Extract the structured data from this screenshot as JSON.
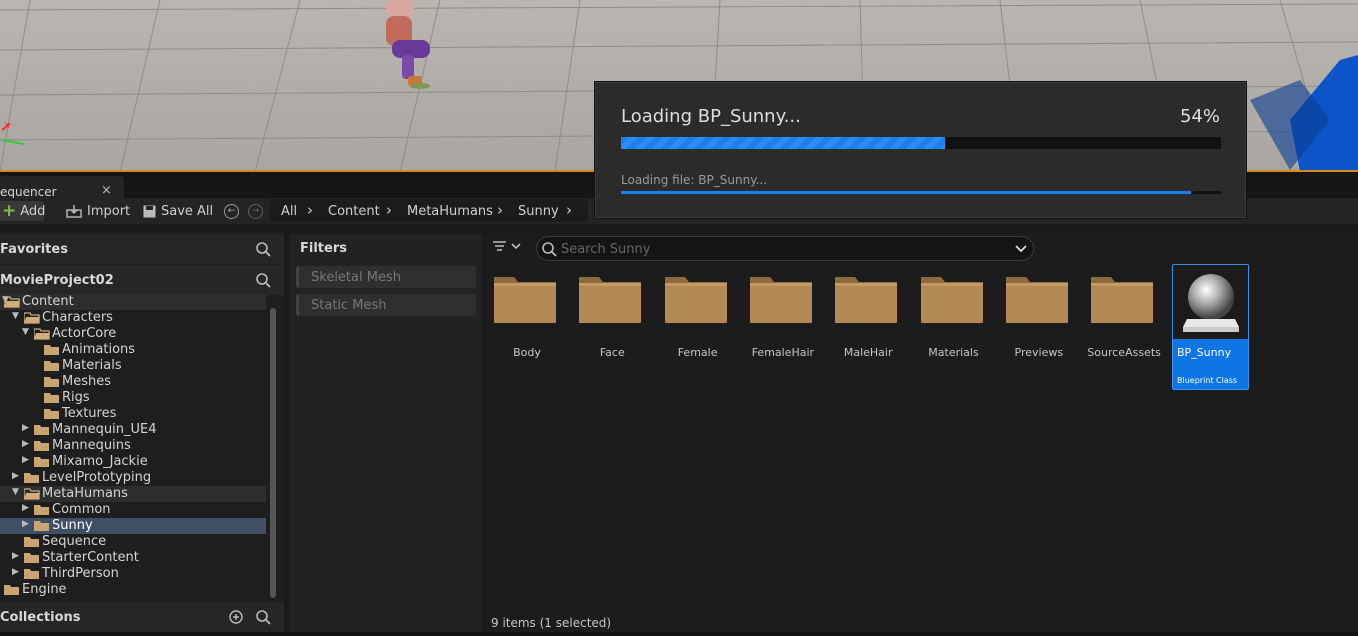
{
  "tab": {
    "label": "equencer",
    "close": "×"
  },
  "toolbar": {
    "add": "Add",
    "import": "Import",
    "save_all": "Save All",
    "breadcrumb": [
      "All",
      "Content",
      "MetaHumans",
      "Sunny"
    ]
  },
  "left": {
    "favorites": "Favorites",
    "project": "MovieProject02",
    "collections": "Collections",
    "tree": [
      {
        "label": "Content",
        "depth": 0,
        "expanded": true,
        "state": "hl"
      },
      {
        "label": "Characters",
        "depth": 1,
        "expanded": true
      },
      {
        "label": "ActorCore",
        "depth": 2,
        "expanded": true
      },
      {
        "label": "Animations",
        "depth": 3
      },
      {
        "label": "Materials",
        "depth": 3
      },
      {
        "label": "Meshes",
        "depth": 3
      },
      {
        "label": "Rigs",
        "depth": 3
      },
      {
        "label": "Textures",
        "depth": 3
      },
      {
        "label": "Mannequin_UE4",
        "depth": 2,
        "expanded": false
      },
      {
        "label": "Mannequins",
        "depth": 2,
        "expanded": false
      },
      {
        "label": "Mixamo_Jackie",
        "depth": 2,
        "expanded": false
      },
      {
        "label": "LevelPrototyping",
        "depth": 1,
        "expanded": false
      },
      {
        "label": "MetaHumans",
        "depth": 1,
        "expanded": true,
        "state": "hl"
      },
      {
        "label": "Common",
        "depth": 2,
        "expanded": false
      },
      {
        "label": "Sunny",
        "depth": 2,
        "expanded": false,
        "state": "sel"
      },
      {
        "label": "Sequence",
        "depth": 1
      },
      {
        "label": "StarterContent",
        "depth": 1,
        "expanded": false
      },
      {
        "label": "ThirdPerson",
        "depth": 1,
        "expanded": false
      },
      {
        "label": "Engine",
        "depth": 0
      }
    ]
  },
  "filters": {
    "title": "Filters",
    "items": [
      "Skeletal Mesh",
      "Static Mesh"
    ]
  },
  "assets": {
    "search_placeholder": "Search Sunny",
    "folders": [
      "Body",
      "Face",
      "Female",
      "FemaleHair",
      "MaleHair",
      "Materials",
      "Previews",
      "SourceAssets"
    ],
    "blueprint": {
      "name": "BP_Sunny",
      "type": "Blueprint Class"
    },
    "status": "9 items (1 selected)"
  },
  "loading": {
    "title": "Loading BP_Sunny...",
    "percent_label": "54%",
    "progress": 0.54,
    "file": "Loading file: BP_Sunny...",
    "file_progress": 0.95
  },
  "colors": {
    "accent": "#1d7ef2",
    "folder": "#b38a55",
    "selection": "#3e4f66"
  }
}
